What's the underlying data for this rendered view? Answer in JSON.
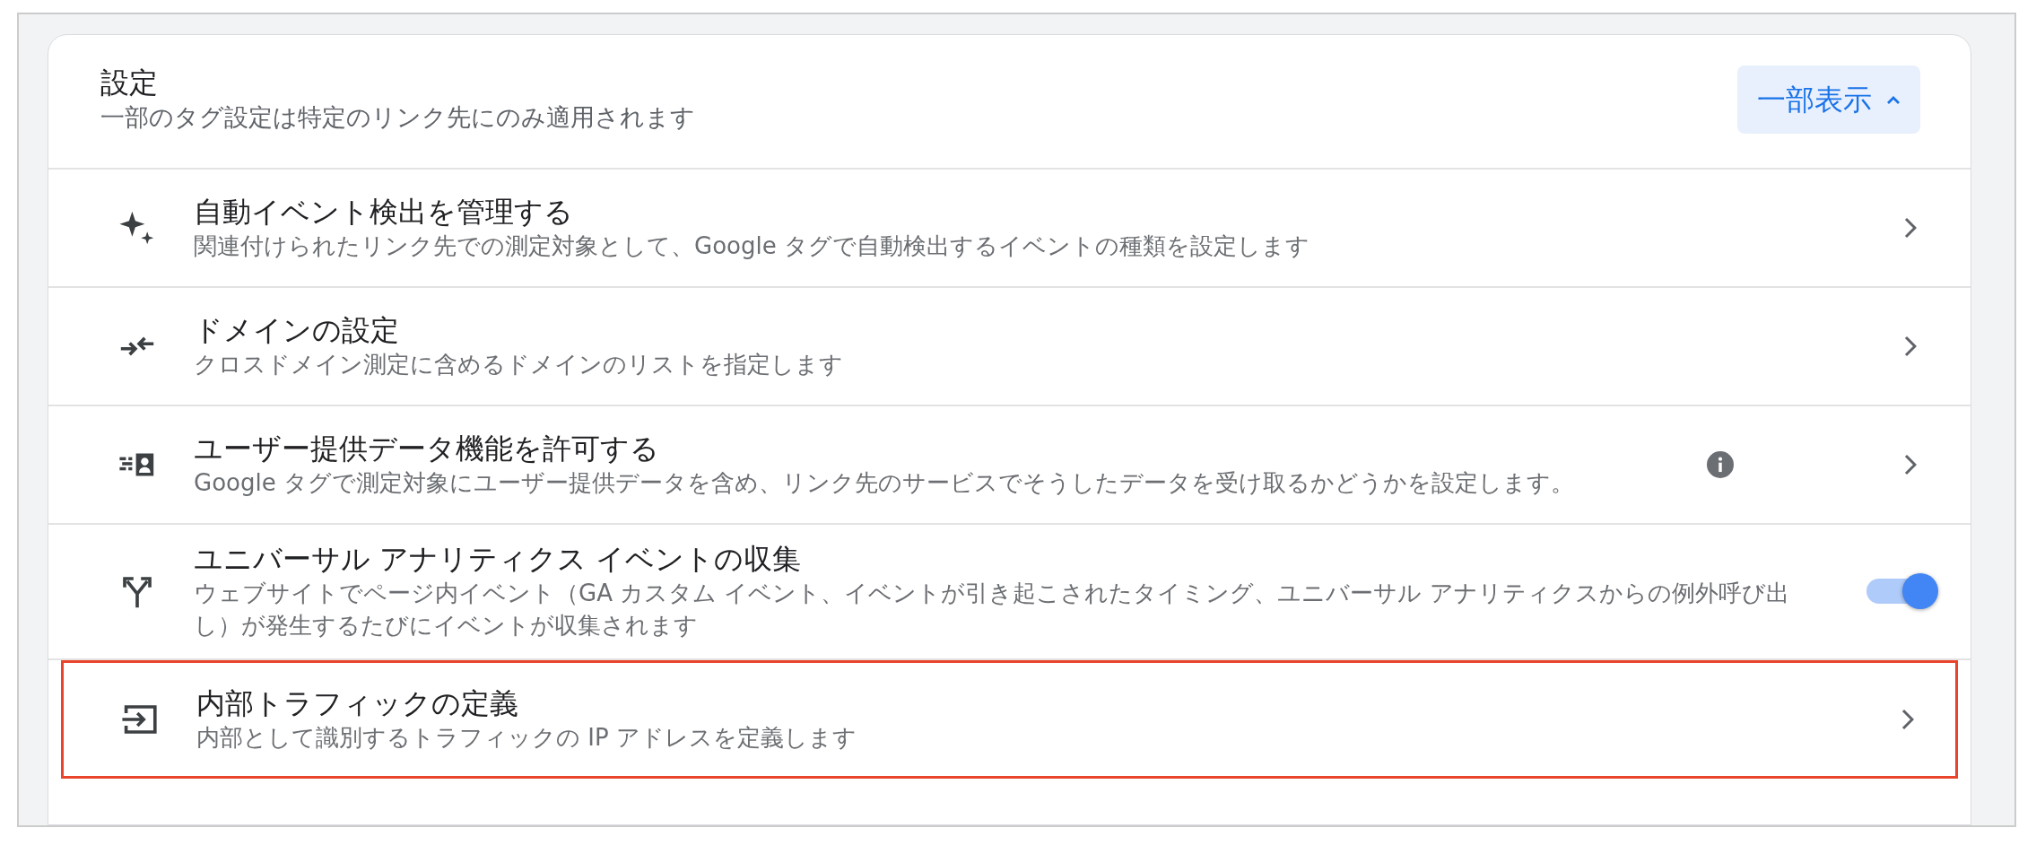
{
  "header": {
    "title": "設定",
    "subtitle": "一部のタグ設定は特定のリンク先にのみ適用されます",
    "toggle_button": {
      "label": "一部表示",
      "expanded": true
    }
  },
  "settings": [
    {
      "kind": "link",
      "title": "自動イベント検出を管理する",
      "description": "関連付けられたリンク先での測定対象として、Google タグで自動検出するイベントの種類を設定します",
      "info": false,
      "highlighted": false
    },
    {
      "kind": "link",
      "title": "ドメインの設定",
      "description": "クロスドメイン測定に含めるドメインのリストを指定します",
      "info": false,
      "highlighted": false
    },
    {
      "kind": "link",
      "title": "ユーザー提供データ機能を許可する",
      "description": "Google タグで測定対象にユーザー提供データを含め、リンク先のサービスでそうしたデータを受け取るかどうかを設定します。",
      "info": true,
      "highlighted": false
    },
    {
      "kind": "toggle",
      "title": "ユニバーサル アナリティクス イベントの収集",
      "description": "ウェブサイトでページ内イベント（GA カスタム イベント、イベントが引き起こされたタイミング、ユニバーサル アナリティクスからの例外呼び出し）が発生するたびにイベントが収集されます",
      "on": true,
      "highlighted": false
    },
    {
      "kind": "link",
      "title": "内部トラフィックの定義",
      "description": "内部として識別するトラフィックの IP アドレスを定義します",
      "info": false,
      "highlighted": true
    }
  ]
}
